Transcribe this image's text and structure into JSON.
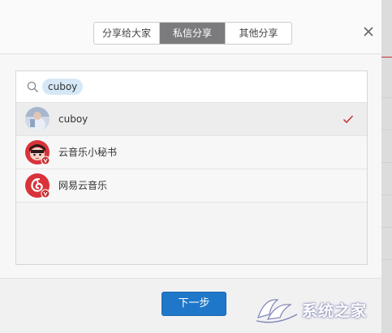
{
  "tabs": [
    {
      "label": "分享给大家",
      "active": false
    },
    {
      "label": "私信分享",
      "active": true
    },
    {
      "label": "其他分享",
      "active": false
    }
  ],
  "search": {
    "query": "cuboy"
  },
  "results": [
    {
      "name": "cuboy",
      "selected": true,
      "avatar": "photo-avatar"
    },
    {
      "name": "云音乐小秘书",
      "selected": false,
      "avatar": "cartoon-avatar-verified"
    },
    {
      "name": "网易云音乐",
      "selected": false,
      "avatar": "netease-logo-verified"
    }
  ],
  "footer": {
    "next_label": "下一步"
  },
  "watermark": {
    "text": "系统之家"
  },
  "colors": {
    "accent_blue": "#1f77c9",
    "active_tab": "#7b7b7d",
    "check_red": "#c62f2f",
    "chip_bg": "#d6e8f7"
  }
}
